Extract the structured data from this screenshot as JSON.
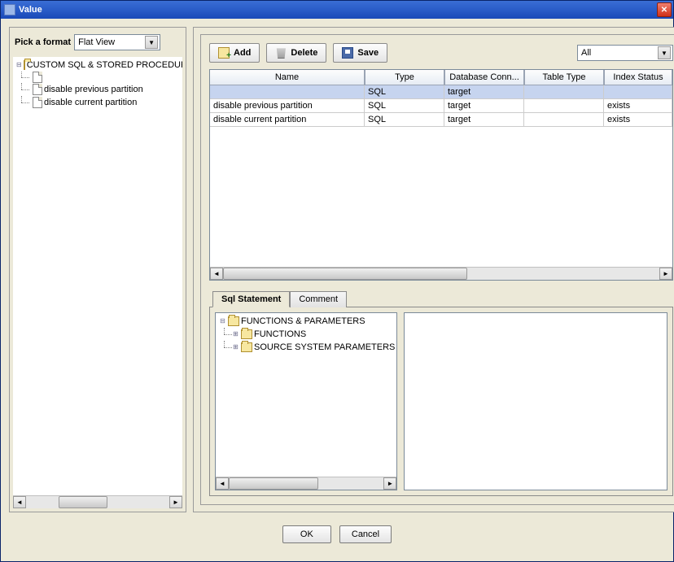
{
  "window": {
    "title": "Value"
  },
  "left": {
    "format_label": "Pick a format",
    "format_value": "Flat View",
    "root": "CUSTOM SQL & STORED PROCEDURES",
    "children": [
      {
        "label": ""
      },
      {
        "label": "disable previous partition"
      },
      {
        "label": "disable current partition"
      }
    ]
  },
  "toolbar": {
    "add": "Add",
    "delete": "Delete",
    "save": "Save",
    "filter_value": "All"
  },
  "table": {
    "headers": [
      "Name",
      "Type",
      "Database Conn...",
      "Table Type",
      "Index Status"
    ],
    "rows": [
      {
        "selected": true,
        "cells": [
          "",
          "SQL",
          "target",
          "",
          ""
        ]
      },
      {
        "selected": false,
        "cells": [
          "disable previous partition",
          "SQL",
          "target",
          "",
          "exists"
        ]
      },
      {
        "selected": false,
        "cells": [
          "disable current partition",
          "SQL",
          "target",
          "",
          "exists"
        ]
      }
    ]
  },
  "tabs": {
    "items": [
      {
        "label": "Sql Statement",
        "active": true
      },
      {
        "label": "Comment",
        "active": false
      }
    ],
    "tree": {
      "root": "FUNCTIONS & PARAMETERS",
      "children": [
        {
          "label": "FUNCTIONS"
        },
        {
          "label": "SOURCE SYSTEM PARAMETERS"
        }
      ]
    }
  },
  "buttons": {
    "ok": "OK",
    "cancel": "Cancel"
  }
}
